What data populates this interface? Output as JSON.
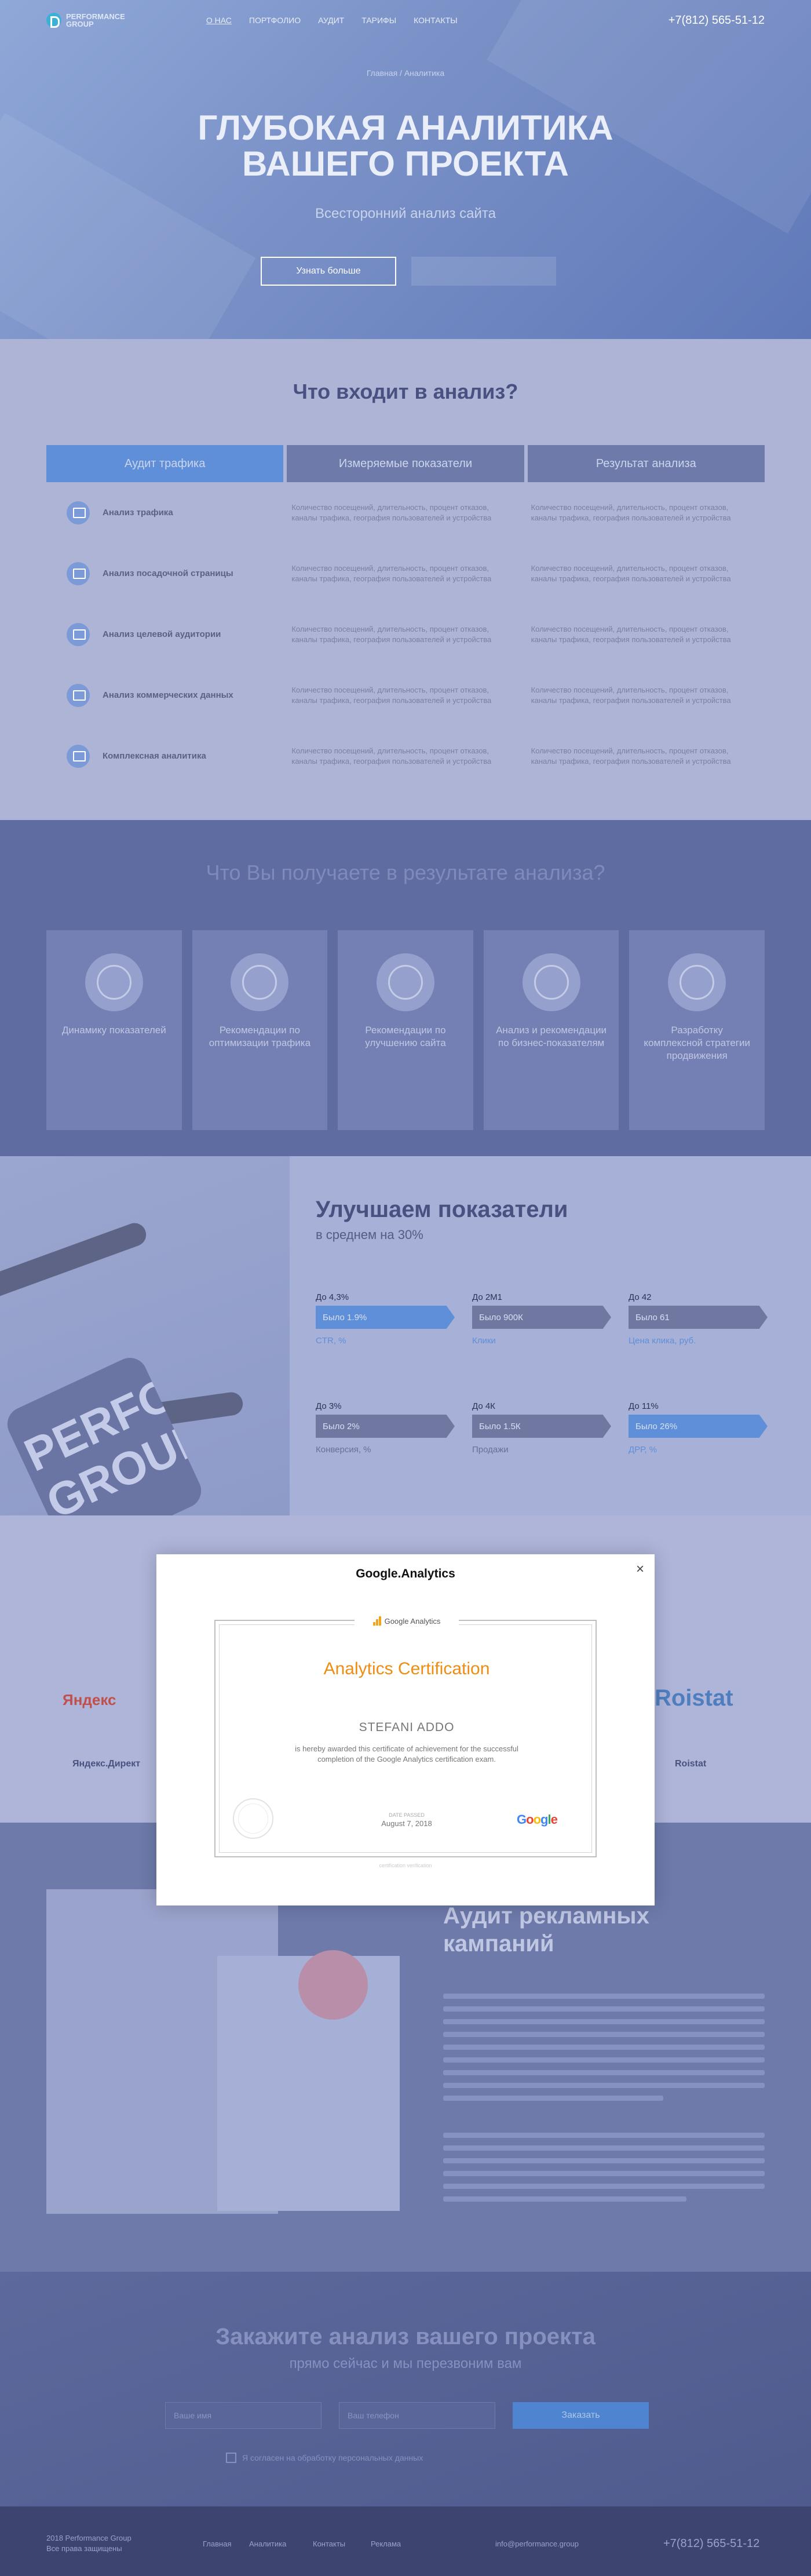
{
  "header": {
    "logo_line1": "PERFORMANCE",
    "logo_line2": "GROUP",
    "nav": [
      "О НАС",
      "ПОРТФОЛИО",
      "АУДИТ",
      "ТАРИФЫ",
      "КОНТАКТЫ"
    ],
    "phone": "+7(812) 565-51-12"
  },
  "hero": {
    "breadcrumb": "Главная / Аналитика",
    "title_line1": "ГЛУБОКАЯ АНАЛИТИКА",
    "title_line2": "ВАШЕГО ПРОЕКТА",
    "subtitle": "Всесторонний анализ сайта",
    "button": "Узнать больше"
  },
  "analysis": {
    "title": "Что входит в анализ?",
    "tabs": [
      "Аудит трафика",
      "Измеряемые показатели",
      "Результат анализа"
    ],
    "rows": [
      {
        "label": "Анализ трафика"
      },
      {
        "label": "Анализ посадочной страницы"
      },
      {
        "label": "Анализ целевой аудитории"
      },
      {
        "label": "Анализ коммерческих данных"
      },
      {
        "label": "Комплексная аналитика"
      }
    ],
    "cell_text": "Количество посещений, длительность, процент отказов, каналы трафика, география пользователей и устройства"
  },
  "results": {
    "title": "Что Вы получаете в результате анализа?",
    "cards": [
      "Динамику показателей",
      "Рекомендации по оптимизации трафика",
      "Рекомендации по улучшению сайта",
      "Анализ и рекомендации по бизнес-показателям",
      "Разработку комплексной стратегии продвижения"
    ]
  },
  "improve": {
    "title": "Улучшаем показатели",
    "subtitle": "в среднем на 30%",
    "phone_word": "PERFORMANCE GROUP",
    "stats": [
      {
        "top": "До 4,3%",
        "bar": "Было 1.9%",
        "bottom": "CTR, %"
      },
      {
        "top": "До 2М1",
        "bar": "Было 900К",
        "bottom": "Клики"
      },
      {
        "top": "До 42",
        "bar": "Было 61",
        "bottom": "Цена клика, руб."
      },
      {
        "top": "До 3%",
        "bar": "Было 2%",
        "bottom": "Конверсия, %"
      },
      {
        "top": "До 4К",
        "bar": "Было 1.5К",
        "bottom": "Продажи"
      },
      {
        "top": "До 11%",
        "bar": "Было 26%",
        "bottom": "ДРР, %"
      }
    ]
  },
  "tools": {
    "yandex_logo": "Яндекс",
    "yandex_label": "Яндекс.Директ",
    "roistat_logo": "Roistat",
    "roistat_label": "Roistat"
  },
  "campaign": {
    "title_line1": "Аудит рекламных",
    "title_line2": "кампаний"
  },
  "order": {
    "title": "Закажите анализ вашего проекта",
    "subtitle": "прямо сейчас и мы перезвоним вам",
    "name_placeholder": "Ваше имя",
    "phone_placeholder": "Ваш телефон",
    "button": "Заказать",
    "agree": "Я согласен на обработку персональных данных"
  },
  "footer": {
    "copy1": "2018 Performance Group",
    "copy2": "Все права защищены",
    "links": [
      "Главная",
      "Аналитика",
      "Контакты",
      "Реклама"
    ],
    "email": "info@performance.group",
    "phone": "+7(812) 565-51-12"
  },
  "modal": {
    "title": "Google.Analytics",
    "close": "×",
    "cert_brand": "Google Analytics",
    "cert_heading": "Analytics Certification",
    "cert_name": "STEFANI ADDO",
    "cert_text_1": "is hereby awarded this certificate of achievement for the successful",
    "cert_text_2": "completion of the Google Analytics certification exam.",
    "date_label": "DATE PASSED",
    "date": "August 7, 2018",
    "google_logo": "Google",
    "footer_note": "certification verification"
  },
  "colors": {
    "overlay": "#5f6ca1",
    "accent_blue": "#5f8fd8",
    "cert_orange": "#ef8c12"
  }
}
